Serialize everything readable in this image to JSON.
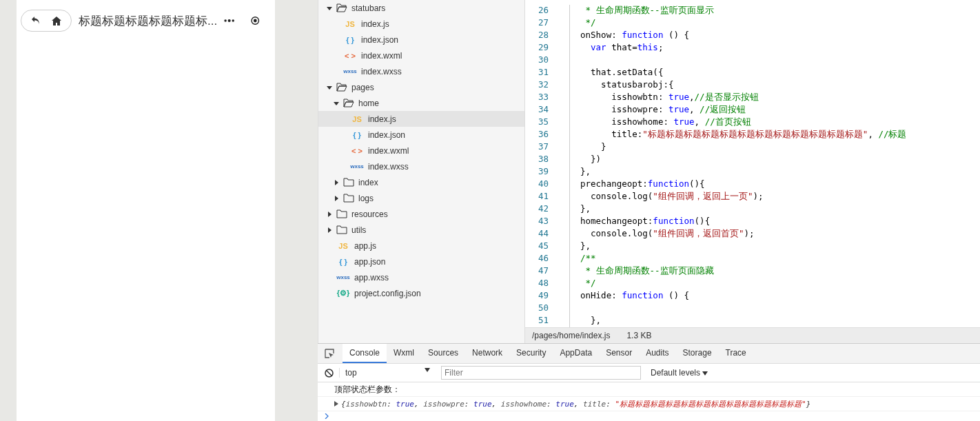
{
  "phone": {
    "nav_title": "标题标题标题标题标题标...",
    "show_back": true,
    "show_home": true
  },
  "tree": [
    {
      "name": "statubars",
      "kind": "folder",
      "expanded": true,
      "children": [
        {
          "name": "index.js",
          "kind": "js",
          "badge": "JS",
          "selected": false
        },
        {
          "name": "index.json",
          "kind": "json",
          "badge": "{ }",
          "selected": false
        },
        {
          "name": "index.wxml",
          "kind": "wxml",
          "badge": "< >",
          "selected": false
        },
        {
          "name": "index.wxss",
          "kind": "wxss",
          "badge": "wxss",
          "selected": false
        }
      ]
    },
    {
      "name": "pages",
      "kind": "folder",
      "expanded": true,
      "children": [
        {
          "name": "home",
          "kind": "folder",
          "expanded": true,
          "children": [
            {
              "name": "index.js",
              "kind": "js",
              "badge": "JS",
              "selected": true
            },
            {
              "name": "index.json",
              "kind": "json",
              "badge": "{ }",
              "selected": false
            },
            {
              "name": "index.wxml",
              "kind": "wxml",
              "badge": "< >",
              "selected": false
            },
            {
              "name": "index.wxss",
              "kind": "wxss",
              "badge": "wxss",
              "selected": false
            }
          ]
        },
        {
          "name": "index",
          "kind": "folder",
          "expanded": false
        },
        {
          "name": "logs",
          "kind": "folder",
          "expanded": false
        }
      ]
    },
    {
      "name": "resources",
      "kind": "folder",
      "expanded": false
    },
    {
      "name": "utils",
      "kind": "folder",
      "expanded": false
    },
    {
      "name": "app.js",
      "kind": "js",
      "badge": "JS",
      "selected": false
    },
    {
      "name": "app.json",
      "kind": "json",
      "badge": "{ }",
      "selected": false
    },
    {
      "name": "app.wxss",
      "kind": "wxss",
      "badge": "wxss",
      "selected": false
    },
    {
      "name": "project.config.json",
      "kind": "config",
      "badge": "{⚙}",
      "selected": false
    }
  ],
  "editor": {
    "lines": [
      {
        "number": "26",
        "tokens": [
          {
            "kind": "comment",
            "text": " * 生命周期函数--监听页面显示"
          }
        ]
      },
      {
        "number": "27",
        "tokens": [
          {
            "kind": "comment",
            "text": " */"
          }
        ]
      },
      {
        "number": "28",
        "tokens": [
          {
            "kind": "plain",
            "text": "onShow: "
          },
          {
            "kind": "keyword",
            "text": "function"
          },
          {
            "kind": "plain",
            "text": " () {"
          }
        ]
      },
      {
        "number": "29",
        "tokens": [
          {
            "kind": "keyword",
            "text": "  var"
          },
          {
            "kind": "plain",
            "text": " that="
          },
          {
            "kind": "keyword",
            "text": "this"
          },
          {
            "kind": "plain",
            "text": ";"
          }
        ]
      },
      {
        "number": "30"
      },
      {
        "number": "31",
        "tokens": [
          {
            "kind": "plain",
            "text": "  that.setData({"
          }
        ]
      },
      {
        "number": "32",
        "tokens": [
          {
            "kind": "plain",
            "text": "    statusbarobj:{"
          }
        ]
      },
      {
        "number": "33",
        "tokens": [
          {
            "kind": "plain",
            "text": "      isshowbtn: "
          },
          {
            "kind": "keyword",
            "text": "true"
          },
          {
            "kind": "plain",
            "text": ","
          },
          {
            "kind": "comment",
            "text": "//是否显示按钮"
          }
        ]
      },
      {
        "number": "34",
        "tokens": [
          {
            "kind": "plain",
            "text": "      isshowpre: "
          },
          {
            "kind": "keyword",
            "text": "true"
          },
          {
            "kind": "plain",
            "text": ", "
          },
          {
            "kind": "comment",
            "text": "//返回按钮"
          }
        ]
      },
      {
        "number": "35",
        "tokens": [
          {
            "kind": "plain",
            "text": "      isshowhome: "
          },
          {
            "kind": "keyword",
            "text": "true"
          },
          {
            "kind": "plain",
            "text": ", "
          },
          {
            "kind": "comment",
            "text": "//首页按钮"
          }
        ]
      },
      {
        "number": "36",
        "tokens": [
          {
            "kind": "plain",
            "text": "      title:"
          },
          {
            "kind": "string",
            "text": "\"标题标题标题标题标题标题标题标题标题标题标题标题\""
          },
          {
            "kind": "plain",
            "text": ", "
          },
          {
            "kind": "comment",
            "text": "//标题"
          }
        ]
      },
      {
        "number": "37",
        "tokens": [
          {
            "kind": "plain",
            "text": "    }"
          }
        ]
      },
      {
        "number": "38",
        "tokens": [
          {
            "kind": "plain",
            "text": "  })"
          }
        ]
      },
      {
        "number": "39",
        "tokens": [
          {
            "kind": "plain",
            "text": "},"
          }
        ]
      },
      {
        "number": "40",
        "tokens": [
          {
            "kind": "plain",
            "text": "prechangeopt:"
          },
          {
            "kind": "keyword",
            "text": "function"
          },
          {
            "kind": "plain",
            "text": "(){"
          }
        ]
      },
      {
        "number": "41",
        "tokens": [
          {
            "kind": "plain",
            "text": "  console.log("
          },
          {
            "kind": "string",
            "text": "\"组件回调，返回上一页\""
          },
          {
            "kind": "plain",
            "text": ");"
          }
        ]
      },
      {
        "number": "42",
        "tokens": [
          {
            "kind": "plain",
            "text": "},"
          }
        ]
      },
      {
        "number": "43",
        "tokens": [
          {
            "kind": "plain",
            "text": "homechangeopt:"
          },
          {
            "kind": "keyword",
            "text": "function"
          },
          {
            "kind": "plain",
            "text": "(){"
          }
        ]
      },
      {
        "number": "44",
        "tokens": [
          {
            "kind": "plain",
            "text": "  console.log("
          },
          {
            "kind": "string",
            "text": "\"组件回调，返回首页\""
          },
          {
            "kind": "plain",
            "text": ");"
          }
        ]
      },
      {
        "number": "45",
        "tokens": [
          {
            "kind": "plain",
            "text": "},"
          }
        ]
      },
      {
        "number": "46",
        "tokens": [
          {
            "kind": "comment",
            "text": "/**"
          }
        ]
      },
      {
        "number": "47",
        "tokens": [
          {
            "kind": "comment",
            "text": " * 生命周期函数--监听页面隐藏"
          }
        ]
      },
      {
        "number": "48",
        "tokens": [
          {
            "kind": "comment",
            "text": " */"
          }
        ]
      },
      {
        "number": "49",
        "tokens": [
          {
            "kind": "plain",
            "text": "onHide: "
          },
          {
            "kind": "keyword",
            "text": "function"
          },
          {
            "kind": "plain",
            "text": " () {"
          }
        ]
      },
      {
        "number": "50"
      },
      {
        "number": "51",
        "tokens": [
          {
            "kind": "plain",
            "text": "  },"
          }
        ]
      }
    ],
    "path": "/pages/home/index.js",
    "size": "1.3 KB"
  },
  "devtools": {
    "tabs": [
      {
        "label": "Console",
        "selected": true
      },
      {
        "label": "Wxml",
        "selected": false
      },
      {
        "label": "Sources",
        "selected": false
      },
      {
        "label": "Network",
        "selected": false
      },
      {
        "label": "Security",
        "selected": false
      },
      {
        "label": "AppData",
        "selected": false
      },
      {
        "label": "Sensor",
        "selected": false
      },
      {
        "label": "Audits",
        "selected": false
      },
      {
        "label": "Storage",
        "selected": false
      },
      {
        "label": "Trace",
        "selected": false
      }
    ],
    "context": "top",
    "filter_placeholder": "Filter",
    "levels": "Default levels",
    "logs": [
      {
        "kind": "text",
        "text": "顶部状态栏参数："
      },
      {
        "kind": "object",
        "tokens": [
          {
            "kind": "plain",
            "text": "{"
          },
          {
            "kind": "key",
            "text": "isshowbtn"
          },
          {
            "kind": "plain",
            "text": ": "
          },
          {
            "kind": "value",
            "text": "true"
          },
          {
            "kind": "plain",
            "text": ", "
          },
          {
            "kind": "key",
            "text": "isshowpre"
          },
          {
            "kind": "plain",
            "text": ": "
          },
          {
            "kind": "value",
            "text": "true"
          },
          {
            "kind": "plain",
            "text": ", "
          },
          {
            "kind": "key",
            "text": "isshowhome"
          },
          {
            "kind": "plain",
            "text": ": "
          },
          {
            "kind": "value",
            "text": "true"
          },
          {
            "kind": "plain",
            "text": ", "
          },
          {
            "kind": "key",
            "text": "title"
          },
          {
            "kind": "plain",
            "text": ": "
          },
          {
            "kind": "string",
            "text": "\"标题标题标题标题标题标题标题标题标题标题标题标题\""
          },
          {
            "kind": "plain",
            "text": "}"
          }
        ]
      }
    ]
  }
}
